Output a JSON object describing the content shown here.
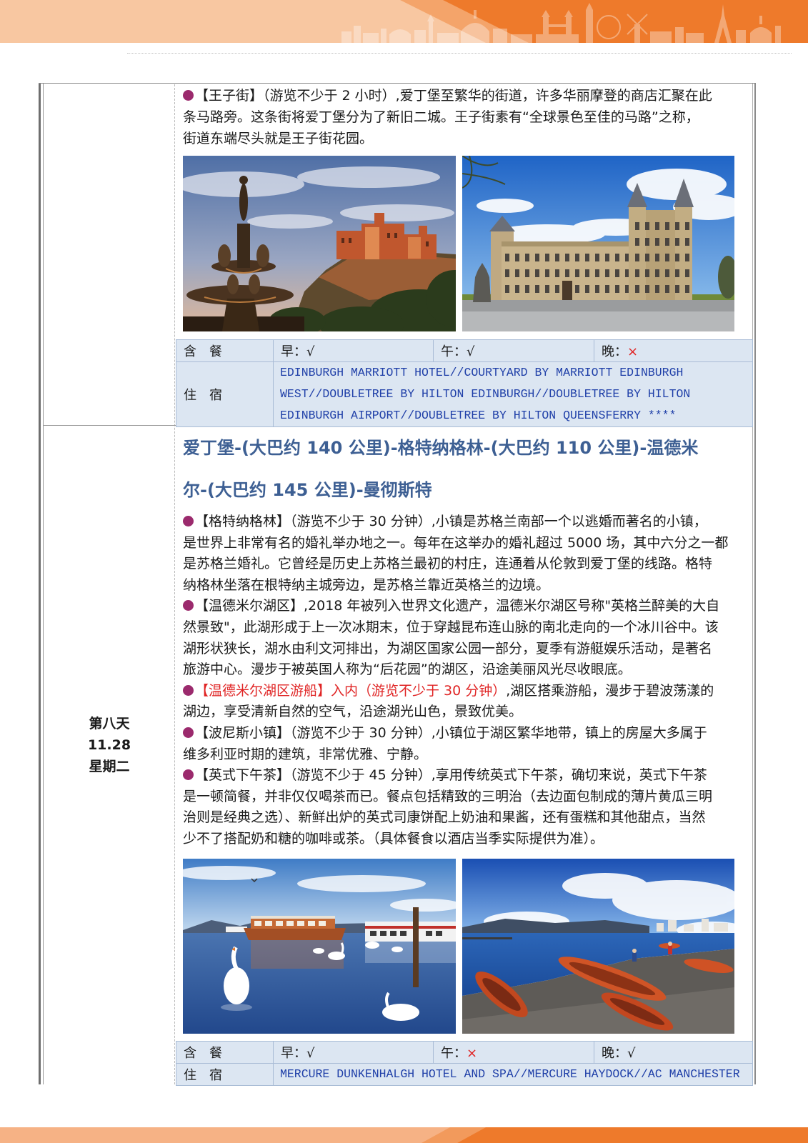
{
  "colors": {
    "accent_orange": "#ee7a2b",
    "title_blue": "#3d5f93",
    "hotel_blue": "#1f3fa8",
    "highlight_red": "#e02424",
    "bullet_purple": "#9b2a6d",
    "cell_blue": "#dce6f2"
  },
  "day7": {
    "intro": {
      "lines": [
        "【王子街】（游览不少于 2 小时）,爱丁堡至繁华的街道，许多华丽摩登的商店汇聚在此",
        "条马路旁。这条街将爱丁堡分为了新旧二城。王子街素有“全球景色至佳的马路”之称，",
        "街道东端尽头就是王子街花园。"
      ]
    },
    "meals": {
      "label": "含　餐",
      "breakfast": {
        "label": "早：",
        "mark": "√"
      },
      "lunch": {
        "label": "午：",
        "mark": "√"
      },
      "dinner": {
        "label": "晚：",
        "mark": "×"
      }
    },
    "hotel": {
      "label": "住　宿",
      "lines": [
        "EDINBURGH MARRIOTT HOTEL//COURTYARD BY MARRIOTT EDINBURGH",
        "WEST//DOUBLETREE BY HILTON EDINBURGH//DOUBLETREE BY HILTON",
        "EDINBURGH AIRPORT//DOUBLETREE BY HILTON QUEENSFERRY ****"
      ]
    }
  },
  "day8": {
    "day_label": "第八天",
    "date": "11.28",
    "weekday": "星期二",
    "title_lines": [
      "爱丁堡-(大巴约 140 公里)-格特纳格林-(大巴约 110 公里)-温德米",
      "尔-(大巴约 145 公里)-曼彻斯特"
    ],
    "paragraphs": [
      {
        "lines": [
          "【格特纳格林】（游览不少于 30 分钟）,小镇是苏格兰南部一个以逃婚而著名的小镇，",
          "是世界上非常有名的婚礼举办地之一。每年在这举办的婚礼超过 5000 场，其中六分之一都",
          "是苏格兰婚礼。它曾经是历史上苏格兰最初的村庄，连通着从伦敦到爱丁堡的线路。格特",
          "纳格林坐落在根特纳主城旁边，是苏格兰靠近英格兰的边境。"
        ]
      },
      {
        "lines": [
          "【温德米尔湖区】,2018 年被列入世界文化遗产，温德米尔湖区号称\"英格兰醉美的大自",
          "然景致\"，此湖形成于上一次冰期末，位于穿越昆布连山脉的南北走向的一个冰川谷中。该",
          "湖形状狭长，湖水由利文河排出，为湖区国家公园一部分，夏季有游艇娱乐活动，是著名",
          "旅游中心。漫步于被英国人称为“后花园”的湖区，沿途美丽风光尽收眼底。"
        ]
      },
      {
        "highlight": "【温德米尔湖区游船】入内（游览不少于 30 分钟）",
        "lines": [
          ",湖区搭乘游船，漫步于碧波荡漾的",
          "湖边，享受清新自然的空气，沿途湖光山色，景致优美。"
        ]
      },
      {
        "lines": [
          "【波尼斯小镇】（游览不少于 30 分钟）,小镇位于湖区繁华地带，镇上的房屋大多属于",
          "维多利亚时期的建筑，非常优雅、宁静。"
        ]
      },
      {
        "lines": [
          "【英式下午茶】（游览不少于 45 分钟）,享用传统英式下午茶，确切来说，英式下午茶",
          "是一顿简餐，并非仅仅喝茶而已。餐点包括精致的三明治（去边面包制成的薄片黄瓜三明",
          "治则是经典之选）、新鲜出炉的英式司康饼配上奶油和果酱，还有蛋糕和其他甜点，当然",
          "少不了搭配奶和糖的咖啡或茶。（具体餐食以酒店当季实际提供为准）。"
        ]
      }
    ],
    "meals": {
      "label": "含　餐",
      "breakfast": {
        "label": "早：",
        "mark": "√"
      },
      "lunch": {
        "label": "午：",
        "mark": "×"
      },
      "dinner": {
        "label": "晚：",
        "mark": "√"
      }
    },
    "hotel": {
      "label": "住　宿",
      "lines": [
        "MERCURE DUNKENHALGH HOTEL AND SPA//MERCURE HAYDOCK//AC MANCHESTER"
      ]
    }
  }
}
